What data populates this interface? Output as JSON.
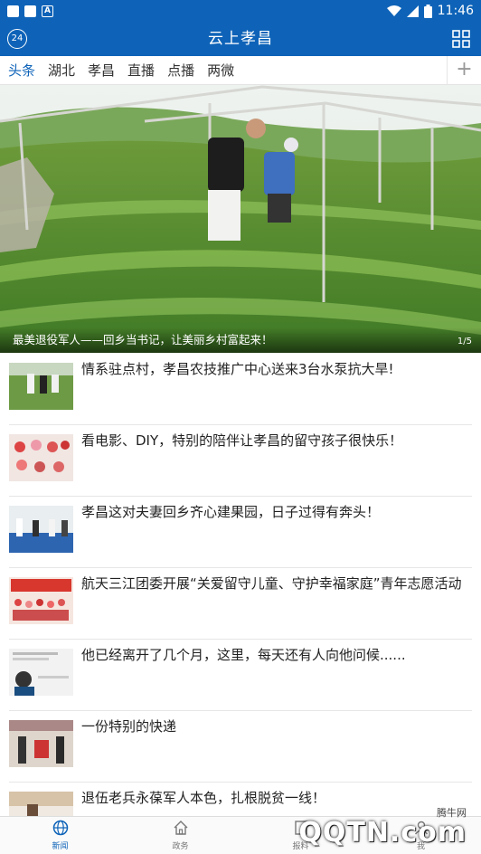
{
  "status_bar": {
    "time": "11:46",
    "icons": [
      "notification-square-icon",
      "notification-square-icon",
      "a-notification-icon",
      "wifi-icon",
      "signal-icon",
      "battery-icon"
    ]
  },
  "header": {
    "title": "云上孝昌",
    "badge_text": "24",
    "menu_icon": "grid-icon",
    "bg_color": "#0e63b8"
  },
  "tabs": {
    "items": [
      "头条",
      "湖北",
      "孝昌",
      "直播",
      "点播",
      "两微"
    ],
    "active": "头条",
    "add_label": "+",
    "active_color": "#0e63b8"
  },
  "hero": {
    "caption": "最美退役军人——回乡当书记，让美丽乡村富起来！",
    "page_current": "1",
    "page_total": "5"
  },
  "news": [
    {
      "title": "情系驻点村，孝昌农技推广中心送来3台水泵抗大旱!"
    },
    {
      "title": "看电影、DIY，特别的陪伴让孝昌的留守孩子很快乐！"
    },
    {
      "title": "孝昌这对夫妻回乡齐心建果园，日子过得有奔头！"
    },
    {
      "title": "航天三江团委开展“关爱留守儿童、守护幸福家庭”青年志愿活动"
    },
    {
      "title": "他已经离开了几个月，这里，每天还有人向他问候......"
    },
    {
      "title": "一份特别的快递"
    },
    {
      "title": "退伍老兵永葆军人本色，扎根脱贫一线！"
    }
  ],
  "bottom_nav": [
    {
      "label": "新闻",
      "icon": "globe-icon",
      "active": true
    },
    {
      "label": "政务",
      "icon": "home-icon",
      "active": false
    },
    {
      "label": "报料",
      "icon": "report-icon",
      "active": false
    },
    {
      "label": "我",
      "icon": "user-icon",
      "active": false
    }
  ],
  "watermark": {
    "small": "腾牛网",
    "big": "QQTN.com"
  }
}
